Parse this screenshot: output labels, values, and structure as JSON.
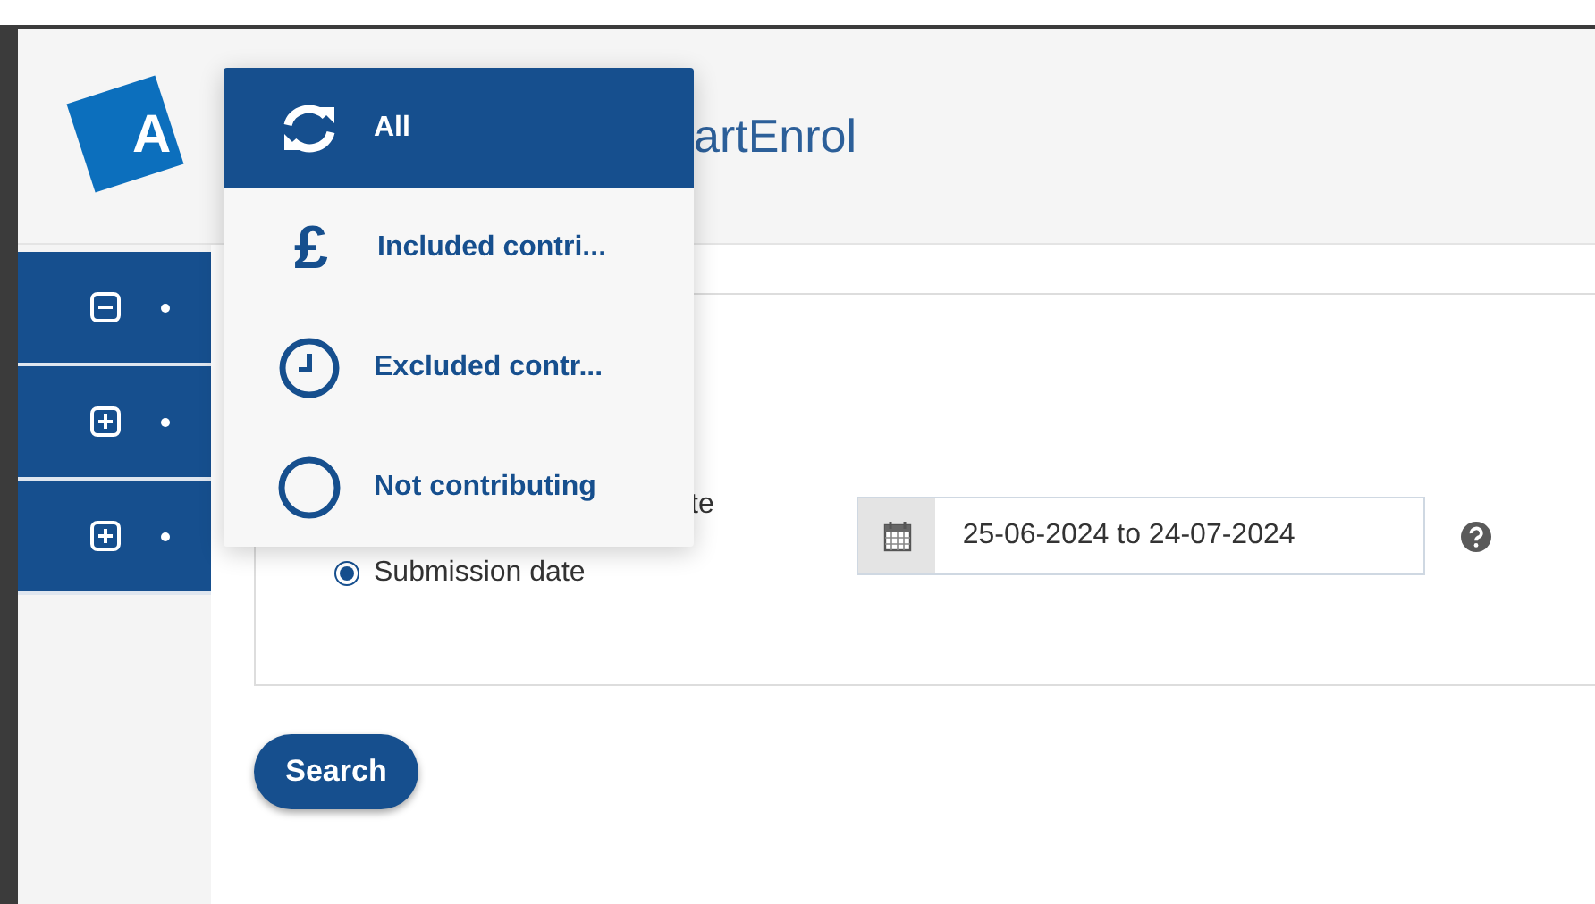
{
  "header": {
    "logo_letter": "A",
    "title": "artEnrol"
  },
  "sidebar": {
    "items": [
      {
        "expanded": true
      },
      {
        "expanded": false
      },
      {
        "expanded": false
      }
    ]
  },
  "filter": {
    "radios": [
      {
        "label": "te"
      },
      {
        "label": "Submission date",
        "selected": true
      }
    ],
    "date_range": {
      "value": "25-06-2024 to 24-07-2024"
    }
  },
  "search_button": "Search",
  "dropdown": {
    "items": [
      {
        "kind": "refresh",
        "label": "All",
        "selected": true
      },
      {
        "kind": "pound",
        "glyph": "£",
        "label": "Included contri...",
        "selected": false
      },
      {
        "kind": "clock",
        "label": "Excluded contr...",
        "selected": false
      },
      {
        "kind": "circle",
        "label": "Not contributing",
        "selected": false
      }
    ]
  }
}
